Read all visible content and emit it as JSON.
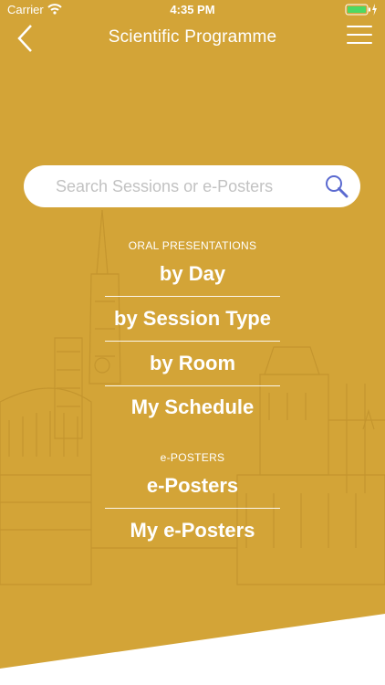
{
  "status_bar": {
    "carrier": "Carrier",
    "time": "4:35 PM",
    "battery_color": "#4cd964"
  },
  "nav": {
    "title": "Scientific Programme",
    "back_icon": "chevron-left-icon",
    "menu_icon": "hamburger-menu-icon"
  },
  "search": {
    "placeholder": "Search Sessions or e-Posters",
    "icon": "magnifier-icon"
  },
  "oral_presentations": {
    "heading": "ORAL PRESENTATIONS",
    "items": [
      "by Day",
      "by Session Type",
      "by Room",
      "My Schedule"
    ]
  },
  "eposters": {
    "heading": "e-POSTERS",
    "items": [
      "e-Posters",
      "My e-Posters"
    ]
  },
  "colors": {
    "background": "#d3a437",
    "search_icon": "#5b6ad0"
  }
}
